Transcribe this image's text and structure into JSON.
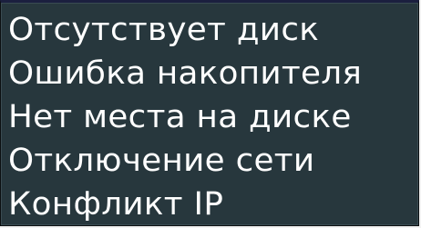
{
  "menu": {
    "items": [
      {
        "label": "Отсутствует диск"
      },
      {
        "label": "Ошибка накопителя"
      },
      {
        "label": "Нет места на диске"
      },
      {
        "label": "Отключение сети"
      },
      {
        "label": "Конфликт IP"
      }
    ]
  },
  "colors": {
    "panel_background": "#27373d",
    "text": "#ffffff",
    "top_border": "#1b1f3f"
  }
}
